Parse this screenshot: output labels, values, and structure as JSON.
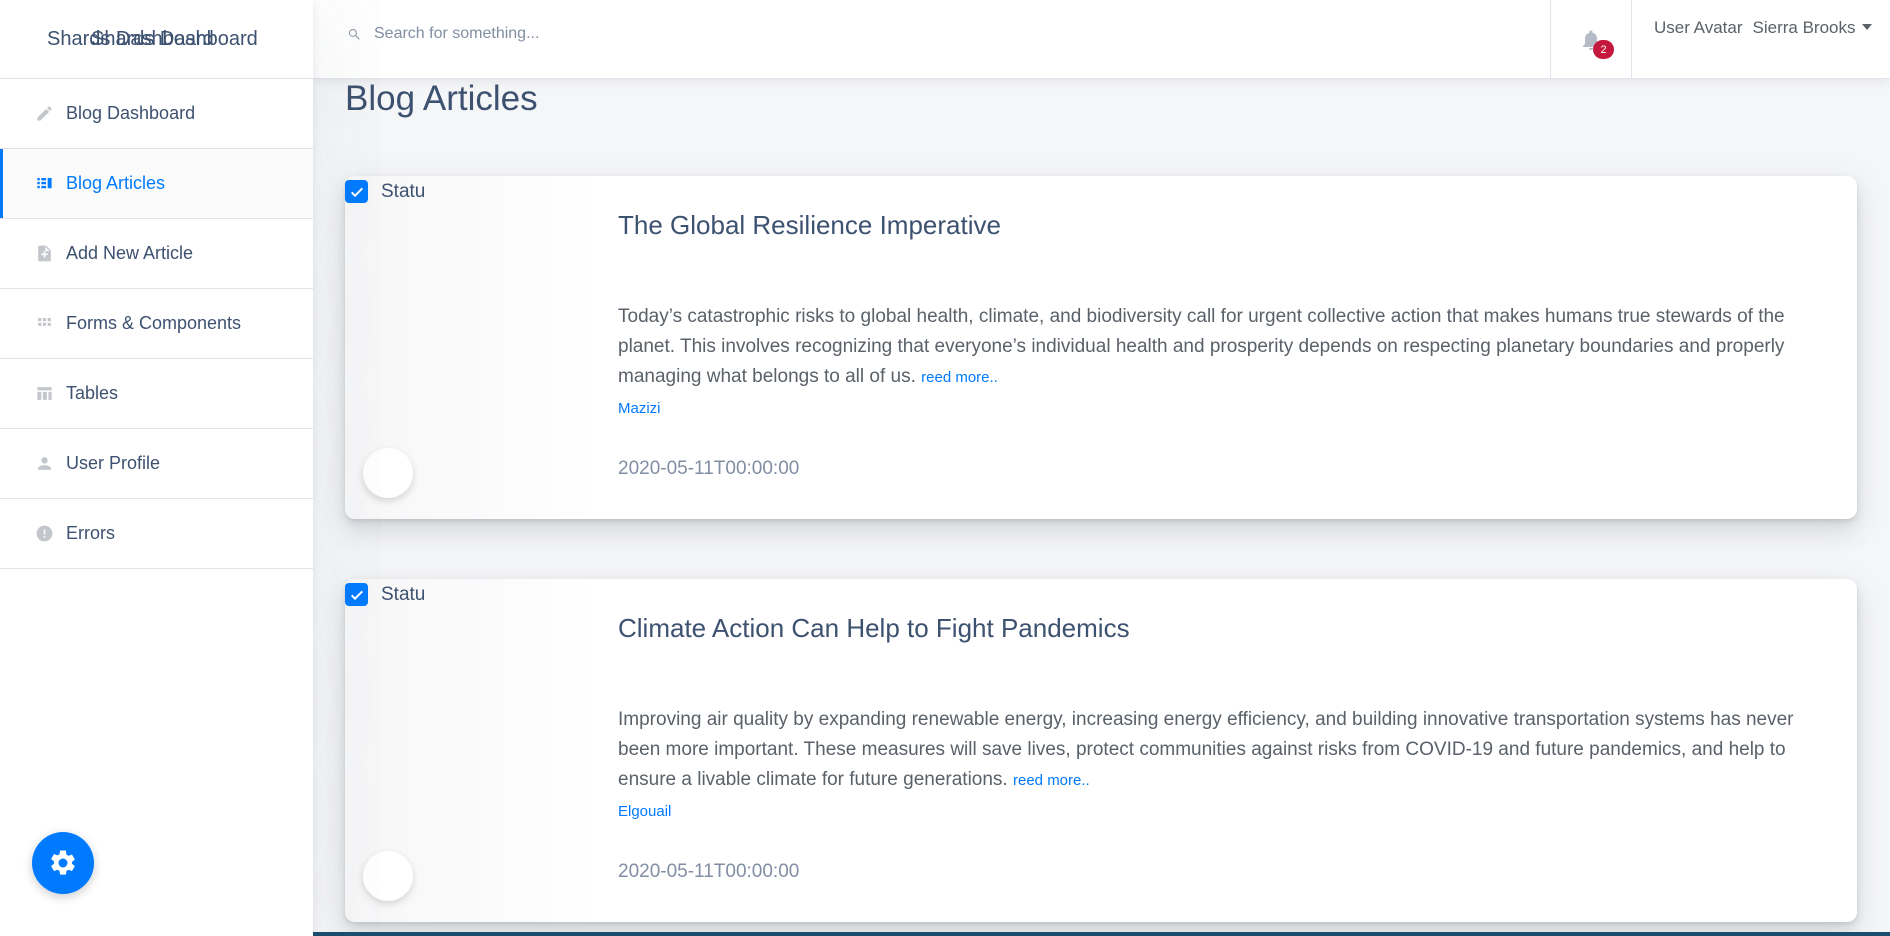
{
  "brand": {
    "title_a": "Shards Dashboard",
    "title_b": "Shards Dashboard"
  },
  "sidebar": {
    "items": [
      {
        "label": "Blog Dashboard",
        "icon": "edit-icon",
        "active": false
      },
      {
        "label": "Blog Articles",
        "icon": "articles-icon",
        "active": true
      },
      {
        "label": "Add New Article",
        "icon": "note-add-icon",
        "active": false
      },
      {
        "label": "Forms & Components",
        "icon": "grid-icon",
        "active": false
      },
      {
        "label": "Tables",
        "icon": "table-icon",
        "active": false
      },
      {
        "label": "User Profile",
        "icon": "person-icon",
        "active": false
      },
      {
        "label": "Errors",
        "icon": "error-icon",
        "active": false
      }
    ]
  },
  "topbar": {
    "search_placeholder": "Search for something...",
    "notification_count": "2",
    "avatar_alt": "User Avatar",
    "user_name": "Sierra Brooks"
  },
  "main": {
    "page_title": "Blog Articles",
    "articles": [
      {
        "status_label": "Statu",
        "title": "The Global Resilience Imperative",
        "body": "Today’s catastrophic risks to global health, climate, and biodiversity call for urgent collective action that makes humans true stewards of the planet. This involves recognizing that everyone’s individual health and prosperity depends on respecting planetary boundaries and properly managing what belongs to all of us.",
        "read_more": "reed more..",
        "author": "Mazizi",
        "date": "2020-05-11T00:00:00"
      },
      {
        "status_label": "Statu",
        "title": "Climate Action Can Help to Fight Pandemics",
        "body": "Improving air quality by expanding renewable energy, increasing energy efficiency, and building innovative transportation systems has never been more important. These measures will save lives, protect communities against risks from COVID-19 and future pandemics, and help to ensure a livable climate for future generations.",
        "read_more": "reed more..",
        "author": "Elgouail",
        "date": "2020-05-11T00:00:00"
      }
    ]
  },
  "colors": {
    "accent": "#007bff",
    "badge": "#c4183c",
    "text": "#3d5170"
  }
}
